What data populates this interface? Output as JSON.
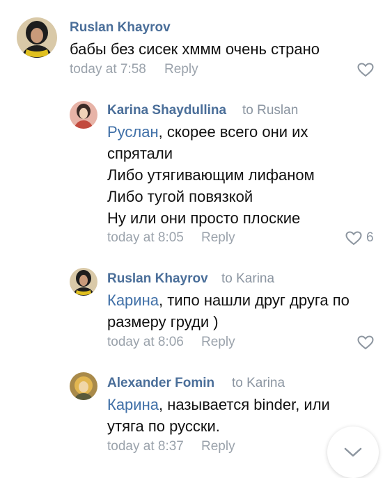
{
  "comments": [
    {
      "author": "Ruslan Khayrov",
      "to": "",
      "mention": "",
      "lines": [
        "бабы без сисек хммм очень страно"
      ],
      "time": "today at 7:58",
      "reply_label": "Reply",
      "likes": ""
    },
    {
      "author": "Karina Shaydullina",
      "to": "to Ruslan",
      "mention": "Руслан",
      "lines": [
        ", скорее всего они их",
        "спрятали",
        "Либо утягивающим лифаном",
        "Либо тугой повязкой",
        "Ну или они просто плоские"
      ],
      "time": "today at 8:05",
      "reply_label": "Reply",
      "likes": "6"
    },
    {
      "author": "Ruslan Khayrov",
      "to": "to Karina",
      "mention": "Карина",
      "lines": [
        ", типо нашли друг друга по",
        "размеру груди )"
      ],
      "time": "today at 8:06",
      "reply_label": "Reply",
      "likes": ""
    },
    {
      "author": "Alexander Fomin",
      "to": "to Karina",
      "mention": "Карина",
      "lines": [
        ", называется binder, или",
        "утяга по русски."
      ],
      "time": "today at 8:37",
      "reply_label": "Reply",
      "likes": ""
    }
  ],
  "icons": {
    "like": "heart-outline-icon",
    "scroll": "chevron-down-icon"
  },
  "colors": {
    "author": "#4a6e99",
    "mention": "#3f6fa7",
    "meta": "#9aa2ab",
    "text": "#111111"
  }
}
